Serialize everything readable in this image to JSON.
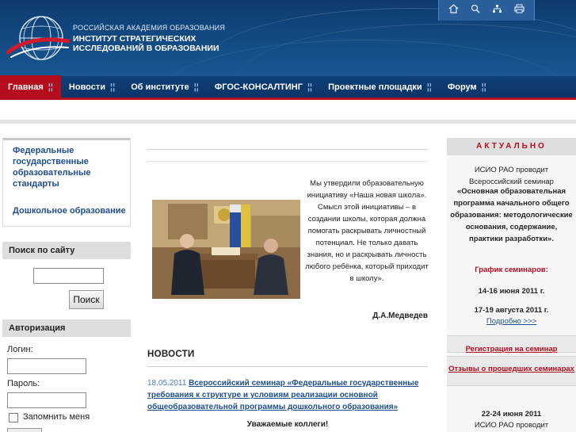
{
  "header": {
    "logo_line1": "РОССИЙСКАЯ АКАДЕМИЯ ОБРАЗОВАНИЯ",
    "logo_line2": "ИНСТИТУТ СТРАТЕГИЧЕСКИХ",
    "logo_line3": "ИССЛЕДОВАНИЙ В ОБРАЗОВАНИИ",
    "icons": [
      "home-icon",
      "search-icon",
      "sitemap-icon",
      "print-icon"
    ]
  },
  "nav": {
    "items": [
      {
        "label": "Главная",
        "active": true
      },
      {
        "label": "Новости"
      },
      {
        "label": "Об институте"
      },
      {
        "label": "ФГОС-КОНСАЛТИНГ"
      },
      {
        "label": "Проектные площадки"
      },
      {
        "label": "Форум"
      }
    ],
    "separator": "¦¦"
  },
  "left": {
    "standards_link": "Федеральные государственные образовательные стандарты",
    "preschool_link": "Дошкольное образование",
    "search_title": "Поиск по сайту",
    "search_value": "",
    "search_button": "Поиск",
    "auth_title": "Авторизация",
    "login_label": "Логин:",
    "login_value": "",
    "password_label": "Пароль:",
    "password_value": "",
    "remember_label": "Запомнить меня"
  },
  "center": {
    "quote": "Мы утвердили образовательную инициативу «Наша новая школа». Смысл этой инициативы – в создании школы, которая должна помогать раскрывать личностный потенциал. Не только давать знания, но и раскрывать личность любого ребёнка, который приходит в школу».",
    "quote_author": "Д.А.Медведев",
    "news_title": "НОВОСТИ",
    "news_date": "18.05.2011",
    "news_link": "Всероссийский семинар «Федеральные государственные требования к структуре и условиям реализации основной общеобразовательной программы дошкольного образования»",
    "news_greeting": "Уважаемые коллеги!"
  },
  "right": {
    "title": "АКТУАЛЬНО",
    "intro": "ИСИО РАО проводит Всероссийский семинар",
    "seminar": "«Основная образовательная программа начального общего образования: методологические основания, содержание, практики разработки».",
    "schedule_title": "График семинаров:",
    "date1": "14-16 июня 2011 г.",
    "date2": "17-19 августа 2011 г.",
    "more_link": "Подробно >>>",
    "register_link": "Регистрация на семинар",
    "reviews_link": "Отзывы о прошедших семинарах",
    "date3": "22-24 июня 2011",
    "date3_text": "ИСИО РАО проводит"
  },
  "colors": {
    "header_blue": "#124880",
    "nav_blue": "#0b3468",
    "accent_red": "#b30d1e",
    "link_blue": "#1e4f8c"
  }
}
